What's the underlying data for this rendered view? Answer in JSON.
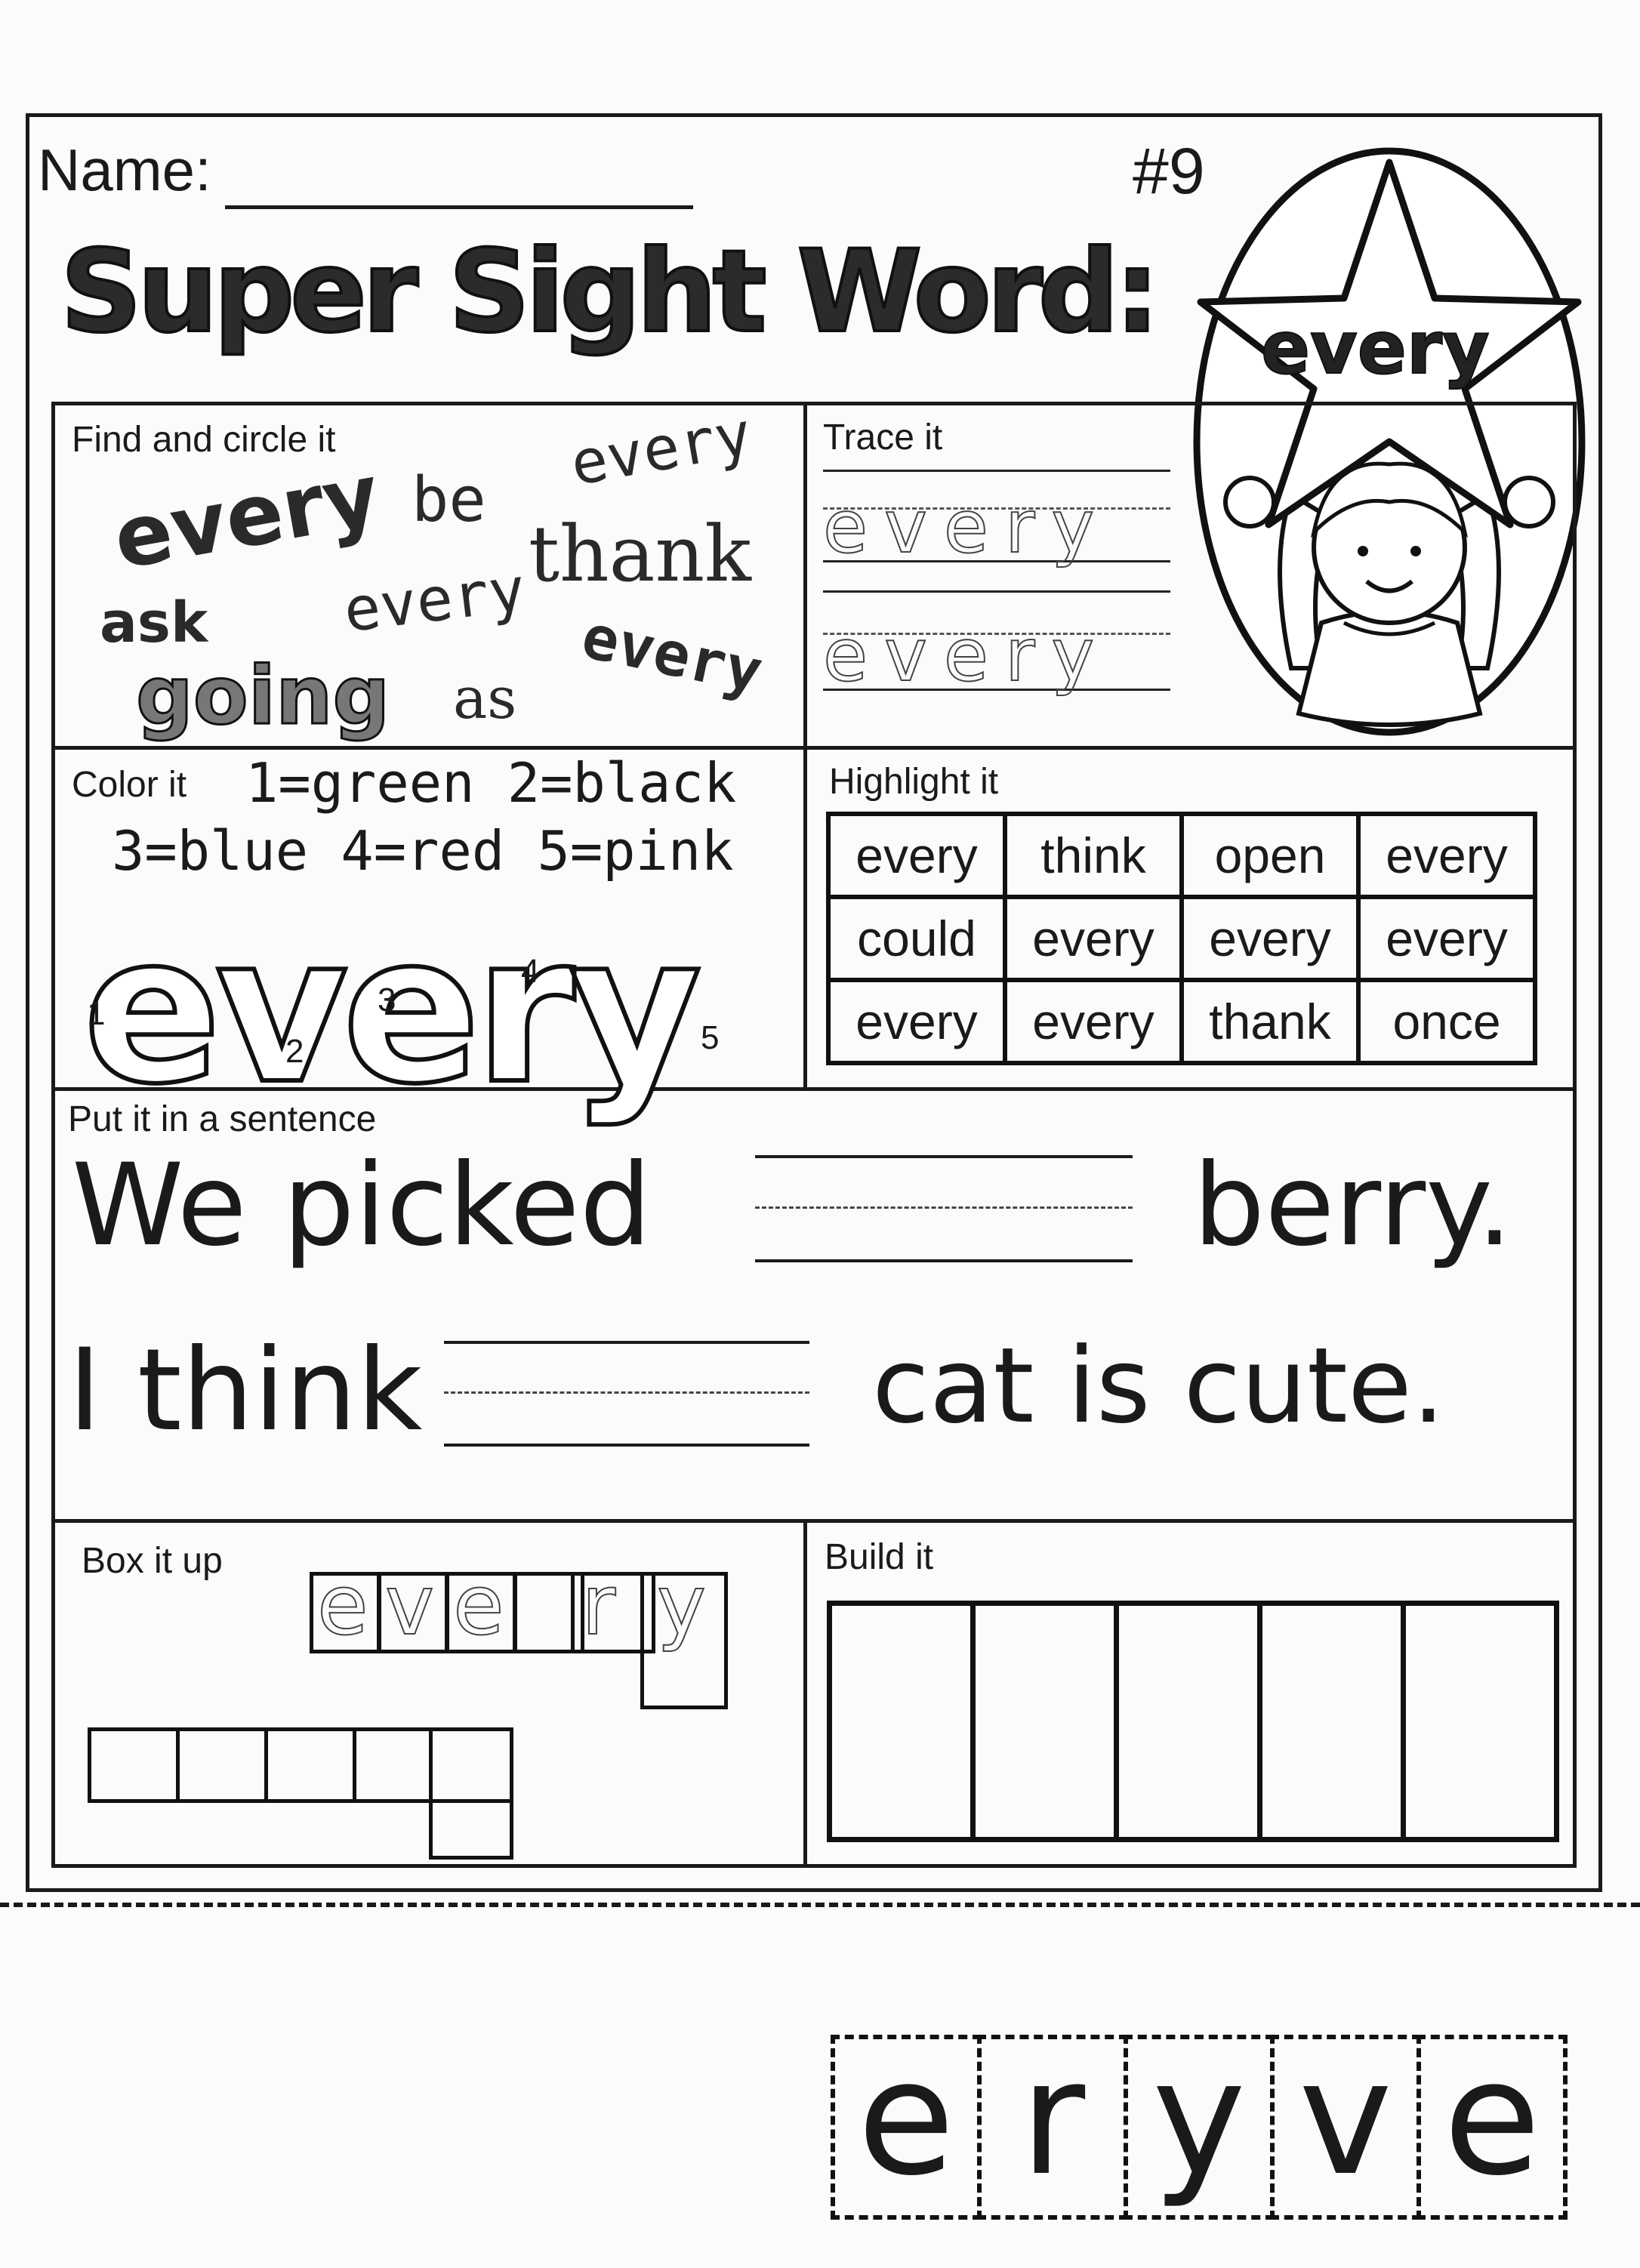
{
  "header": {
    "name_label": "Name:",
    "number": "#9",
    "title": "Super Sight Word:",
    "star_word": "every"
  },
  "find_circle": {
    "label": "Find and circle it",
    "words": [
      "every",
      "be",
      "every",
      "thank",
      "ask",
      "every",
      "every",
      "going",
      "as"
    ]
  },
  "trace": {
    "label": "Trace it",
    "word": "every"
  },
  "color_it": {
    "label": "Color it",
    "key_line1": "1=green 2=black",
    "key_line2": "3=blue 4=red 5=pink",
    "word": "every",
    "region_numbers": [
      "1",
      "2",
      "3",
      "4",
      "5"
    ]
  },
  "highlight": {
    "label": "Highlight it",
    "rows": [
      [
        "every",
        "think",
        "open",
        "every"
      ],
      [
        "could",
        "every",
        "every",
        "every"
      ],
      [
        "every",
        "every",
        "thank",
        "once"
      ]
    ]
  },
  "sentence": {
    "label": "Put it in a sentence",
    "s1_before": "We picked",
    "s1_after": "berry.",
    "s2_before": "I think",
    "s2_after": "cat is cute."
  },
  "box_it": {
    "label": "Box it up",
    "letters": [
      "e",
      "v",
      "e",
      "r",
      "y"
    ]
  },
  "build_it": {
    "label": "Build it"
  },
  "cutout": {
    "letters": [
      "e",
      "r",
      "y",
      "v",
      "e"
    ]
  }
}
